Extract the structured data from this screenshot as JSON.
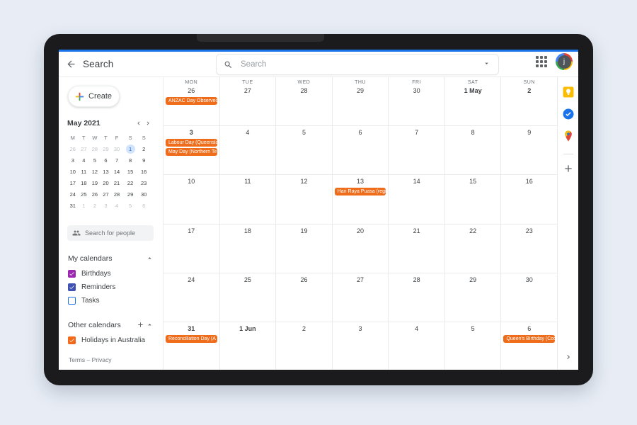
{
  "app": {
    "top": {
      "back_label": "back-arrow",
      "title": "Search",
      "search_placeholder": "Search",
      "search_value": "",
      "avatar_initial": "j"
    },
    "sidebar": {
      "create_label": "Create",
      "mini_calendar": {
        "title": "May 2021",
        "weekday_headers": [
          "M",
          "T",
          "W",
          "T",
          "F",
          "S",
          "S"
        ],
        "weeks": [
          [
            {
              "d": "26",
              "mute": true
            },
            {
              "d": "27",
              "mute": true
            },
            {
              "d": "28",
              "mute": true
            },
            {
              "d": "29",
              "mute": true
            },
            {
              "d": "30",
              "mute": true
            },
            {
              "d": "1",
              "mute": false,
              "selected": true
            },
            {
              "d": "2",
              "mute": false
            }
          ],
          [
            {
              "d": "3",
              "mute": false
            },
            {
              "d": "4",
              "mute": false
            },
            {
              "d": "5",
              "mute": false
            },
            {
              "d": "6",
              "mute": false
            },
            {
              "d": "7",
              "mute": false
            },
            {
              "d": "8",
              "mute": false
            },
            {
              "d": "9",
              "mute": false
            }
          ],
          [
            {
              "d": "10",
              "mute": false
            },
            {
              "d": "11",
              "mute": false
            },
            {
              "d": "12",
              "mute": false
            },
            {
              "d": "13",
              "mute": false
            },
            {
              "d": "14",
              "mute": false
            },
            {
              "d": "15",
              "mute": false
            },
            {
              "d": "16",
              "mute": false
            }
          ],
          [
            {
              "d": "17",
              "mute": false
            },
            {
              "d": "18",
              "mute": false
            },
            {
              "d": "19",
              "mute": false
            },
            {
              "d": "20",
              "mute": false
            },
            {
              "d": "21",
              "mute": false
            },
            {
              "d": "22",
              "mute": false
            },
            {
              "d": "23",
              "mute": false
            }
          ],
          [
            {
              "d": "24",
              "mute": false
            },
            {
              "d": "25",
              "mute": false
            },
            {
              "d": "26",
              "mute": false
            },
            {
              "d": "27",
              "mute": false
            },
            {
              "d": "28",
              "mute": false
            },
            {
              "d": "29",
              "mute": false
            },
            {
              "d": "30",
              "mute": false
            }
          ],
          [
            {
              "d": "31",
              "mute": false
            },
            {
              "d": "1",
              "mute": true
            },
            {
              "d": "2",
              "mute": true
            },
            {
              "d": "3",
              "mute": true
            },
            {
              "d": "4",
              "mute": true
            },
            {
              "d": "5",
              "mute": true
            },
            {
              "d": "6",
              "mute": true
            }
          ]
        ]
      },
      "people_search_placeholder": "Search for people",
      "my_calendars": {
        "label": "My calendars",
        "items": [
          {
            "label": "Birthdays",
            "color": "#9c27b0",
            "checked": true
          },
          {
            "label": "Reminders",
            "color": "#3f51b5",
            "checked": true
          },
          {
            "label": "Tasks",
            "color": "#1a73e8",
            "checked": false
          }
        ]
      },
      "other_calendars": {
        "label": "Other calendars",
        "items": [
          {
            "label": "Holidays in Australia",
            "color": "#f4681a",
            "checked": true
          }
        ]
      },
      "footer": "Terms – Privacy"
    },
    "calendar": {
      "weekday_headers": [
        "MON",
        "TUE",
        "WED",
        "THU",
        "FRI",
        "SAT",
        "SUN"
      ],
      "event_color": "#ef6c1a",
      "weeks": [
        {
          "show_dow": true,
          "days": [
            {
              "num": "26",
              "bold": false,
              "events": [
                "ANZAC Day Observed"
              ]
            },
            {
              "num": "27",
              "bold": false,
              "events": []
            },
            {
              "num": "28",
              "bold": false,
              "events": []
            },
            {
              "num": "29",
              "bold": false,
              "events": []
            },
            {
              "num": "30",
              "bold": false,
              "events": []
            },
            {
              "num": "1 May",
              "bold": true,
              "events": []
            },
            {
              "num": "2",
              "bold": true,
              "events": []
            }
          ]
        },
        {
          "show_dow": false,
          "days": [
            {
              "num": "3",
              "bold": true,
              "events": [
                "Labour Day (Queensla",
                "May Day (Northern Te"
              ]
            },
            {
              "num": "4",
              "bold": false,
              "events": []
            },
            {
              "num": "5",
              "bold": false,
              "events": []
            },
            {
              "num": "6",
              "bold": false,
              "events": []
            },
            {
              "num": "7",
              "bold": false,
              "events": []
            },
            {
              "num": "8",
              "bold": false,
              "events": []
            },
            {
              "num": "9",
              "bold": false,
              "events": []
            }
          ]
        },
        {
          "show_dow": false,
          "days": [
            {
              "num": "10",
              "bold": false,
              "events": []
            },
            {
              "num": "11",
              "bold": false,
              "events": []
            },
            {
              "num": "12",
              "bold": false,
              "events": []
            },
            {
              "num": "13",
              "bold": false,
              "events": [
                "Hari Raya Puasa (regi"
              ]
            },
            {
              "num": "14",
              "bold": false,
              "events": []
            },
            {
              "num": "15",
              "bold": false,
              "events": []
            },
            {
              "num": "16",
              "bold": false,
              "events": []
            }
          ]
        },
        {
          "show_dow": false,
          "days": [
            {
              "num": "17",
              "bold": false,
              "events": []
            },
            {
              "num": "18",
              "bold": false,
              "events": []
            },
            {
              "num": "19",
              "bold": false,
              "events": []
            },
            {
              "num": "20",
              "bold": false,
              "events": []
            },
            {
              "num": "21",
              "bold": false,
              "events": []
            },
            {
              "num": "22",
              "bold": false,
              "events": []
            },
            {
              "num": "23",
              "bold": false,
              "events": []
            }
          ]
        },
        {
          "show_dow": false,
          "days": [
            {
              "num": "24",
              "bold": false,
              "events": []
            },
            {
              "num": "25",
              "bold": false,
              "events": []
            },
            {
              "num": "26",
              "bold": false,
              "events": []
            },
            {
              "num": "27",
              "bold": false,
              "events": []
            },
            {
              "num": "28",
              "bold": false,
              "events": []
            },
            {
              "num": "29",
              "bold": false,
              "events": []
            },
            {
              "num": "30",
              "bold": false,
              "events": []
            }
          ]
        },
        {
          "show_dow": false,
          "days": [
            {
              "num": "31",
              "bold": true,
              "events": [
                "Reconciliation Day (A"
              ]
            },
            {
              "num": "1 Jun",
              "bold": true,
              "events": []
            },
            {
              "num": "2",
              "bold": false,
              "events": []
            },
            {
              "num": "3",
              "bold": false,
              "events": []
            },
            {
              "num": "4",
              "bold": false,
              "events": []
            },
            {
              "num": "5",
              "bold": false,
              "events": []
            },
            {
              "num": "6",
              "bold": false,
              "events": [
                "Queen's Birthday (Coc"
              ]
            }
          ]
        }
      ]
    },
    "right_rail": {
      "icons": [
        "keep-icon",
        "tasks-icon",
        "maps-icon"
      ],
      "add_label": "add-shortcut-icon",
      "expand_label": "expand-rail-icon"
    }
  }
}
